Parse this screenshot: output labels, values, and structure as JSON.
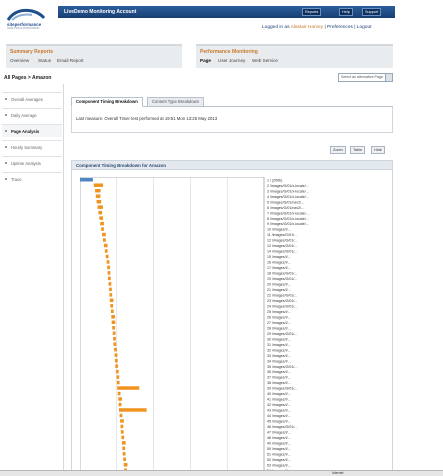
{
  "app": {
    "logo_text": "siteperformance",
    "logo_sub": "ANALYSIS & MONITORING",
    "title": "LiveDemo Monitoring Account",
    "top_buttons": [
      "Reports",
      "Help",
      "Support"
    ]
  },
  "user_links": {
    "prefix": "Logged in as",
    "name": "Alastair Harvey",
    "links": "| Preferences | Logout"
  },
  "nav": {
    "left_heading": "Summary Reports",
    "left_links": [
      "Overview",
      "Status",
      "Email Report"
    ],
    "right_heading": "Performance Monitoring",
    "right_links": [
      "Page",
      "User Journey",
      "Web Service"
    ],
    "active_right": "Page"
  },
  "page_heading": "All Pages > Amazon",
  "page_select": "Select an alternative Page",
  "sidebar": {
    "items": [
      "Overall Averages",
      "Daily Average",
      "Page Analysis",
      "Hourly Summary",
      "Uptime Analysis",
      "Trace"
    ],
    "active_index": 2
  },
  "tabs": {
    "items": [
      "Component Timing Breakdown",
      "Content Type Breakdown"
    ],
    "active_index": 0
  },
  "info_text": "Last measure:  Overall Timer test performed at 19:51 Mon 13:25 May 2013",
  "toolbar": {
    "buttons": [
      "Zoom",
      "Table",
      "Hide"
    ]
  },
  "chart_title": "Component Timing Breakdown for Amazon",
  "chart_data": {
    "type": "bar",
    "orientation": "horizontal-waterfall",
    "xlim": [
      0,
      10
    ],
    "grid": true,
    "legend": "none",
    "bar_color": "#f0941f",
    "first_bar_color": "#4f85c4",
    "categories": [
      "1 / (200b)",
      "2 /images/G/01/x-locale/...",
      "3 /images/G/01/x-locale/...",
      "4 /images/G/01/x-locale/...",
      "5 /images/G/01/nav2/...",
      "6 /images/G/01/nav2/...",
      "7 /images/G/01/x-locale/...",
      "8 /images/G/01/x-locale/...",
      "9 /images/G/01/x-locale/...",
      "10 /images/I/...",
      "11 /images/G/01/...",
      "12 /images/G/01/...",
      "13 /images/G/01/...",
      "14 /images/G/01/...",
      "15 /images/I/...",
      "16 /images/I/...",
      "17 /images/I/...",
      "18 /images/G/01/...",
      "19 /images/G/01/...",
      "20 /images/I/...",
      "21 /images/I/...",
      "22 /images/G/01/...",
      "23 /images/G/01/...",
      "24 /images/G/01/...",
      "25 /images/I/...",
      "26 /images/I/...",
      "27 /images/I/...",
      "28 /images/I/...",
      "29 /images/G/01/...",
      "30 /images/I/...",
      "31 /images/I/...",
      "32 /images/I/...",
      "33 /images/I/...",
      "34 /images/I/...",
      "35 /images/G/01/...",
      "36 /images/I/...",
      "37 /images/I/...",
      "38 /images/I/...",
      "39 /images/G/01/...",
      "40 /images/I/...",
      "41 /images/I/...",
      "42 /images/I/...",
      "43 /images/I/...",
      "44 /images/I/...",
      "45 /images/I/...",
      "46 /images/G/01/...",
      "47 /images/I/...",
      "48 /images/I/...",
      "49 /images/I/...",
      "50 /images/I/...",
      "51 /images/I/...",
      "52 /images/I/...",
      "53 /images/I/...",
      "54 /images/I/..."
    ],
    "starts": [
      0.0,
      0.75,
      0.82,
      0.86,
      0.9,
      0.95,
      1.0,
      1.05,
      1.1,
      1.15,
      1.2,
      1.25,
      1.3,
      1.35,
      1.4,
      1.45,
      1.48,
      1.5,
      1.52,
      1.55,
      1.58,
      1.6,
      1.62,
      1.65,
      1.68,
      1.7,
      1.72,
      1.75,
      1.78,
      1.8,
      1.82,
      1.85,
      1.88,
      1.9,
      1.92,
      1.95,
      1.98,
      2.0,
      2.02,
      2.05,
      2.08,
      2.1,
      2.12,
      2.15,
      2.18,
      2.2,
      2.22,
      2.25,
      2.28,
      2.3,
      2.32,
      2.35,
      2.38,
      2.4
    ],
    "durations": [
      0.7,
      0.5,
      0.3,
      0.25,
      0.25,
      0.3,
      0.2,
      0.2,
      0.2,
      0.15,
      0.2,
      0.15,
      0.2,
      0.15,
      0.15,
      0.15,
      0.15,
      0.15,
      0.15,
      0.15,
      0.15,
      0.15,
      0.2,
      0.15,
      0.15,
      0.2,
      0.2,
      0.15,
      0.15,
      0.15,
      0.15,
      0.15,
      0.15,
      0.15,
      0.15,
      0.15,
      0.15,
      0.15,
      1.2,
      0.15,
      0.2,
      0.15,
      1.5,
      0.15,
      0.2,
      0.15,
      0.15,
      0.15,
      0.2,
      0.15,
      0.15,
      0.15,
      0.2,
      0.15
    ]
  },
  "status_bar": {
    "zone": "Internet"
  }
}
